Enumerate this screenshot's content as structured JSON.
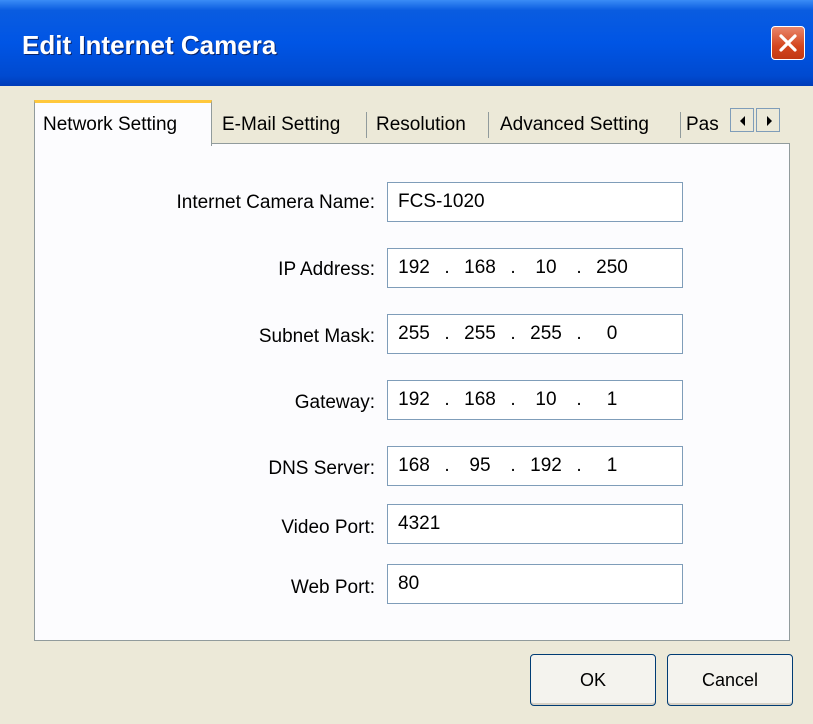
{
  "window": {
    "title": "Edit Internet Camera"
  },
  "tabs": [
    {
      "label": "Network Setting",
      "active": true
    },
    {
      "label": "E-Mail Setting",
      "active": false
    },
    {
      "label": "Resolution",
      "active": false
    },
    {
      "label": "Advanced Setting",
      "active": false
    },
    {
      "label": "Pas",
      "active": false
    }
  ],
  "form": {
    "camera_name": {
      "label": "Internet Camera Name:",
      "value": "FCS-1020"
    },
    "ip_address": {
      "label": "IP Address:",
      "octets": [
        "192",
        "168",
        "10",
        "250"
      ]
    },
    "subnet_mask": {
      "label": "Subnet Mask:",
      "octets": [
        "255",
        "255",
        "255",
        "0"
      ]
    },
    "gateway": {
      "label": "Gateway:",
      "octets": [
        "192",
        "168",
        "10",
        "1"
      ]
    },
    "dns_server": {
      "label": "DNS Server:",
      "octets": [
        "168",
        "95",
        "192",
        "1"
      ]
    },
    "video_port": {
      "label": "Video Port:",
      "value": "4321"
    },
    "web_port": {
      "label": "Web Port:",
      "value": "80"
    }
  },
  "buttons": {
    "ok": "OK",
    "cancel": "Cancel"
  },
  "separator": ".",
  "icons": {
    "close": "close-icon",
    "scroll_left": "arrow-left-icon",
    "scroll_right": "arrow-right-icon"
  },
  "colors": {
    "titlebar": "#0055e5",
    "close": "#d4461e",
    "dialog": "#ece9d8",
    "active_tab_highlight": "#ffc83c"
  }
}
